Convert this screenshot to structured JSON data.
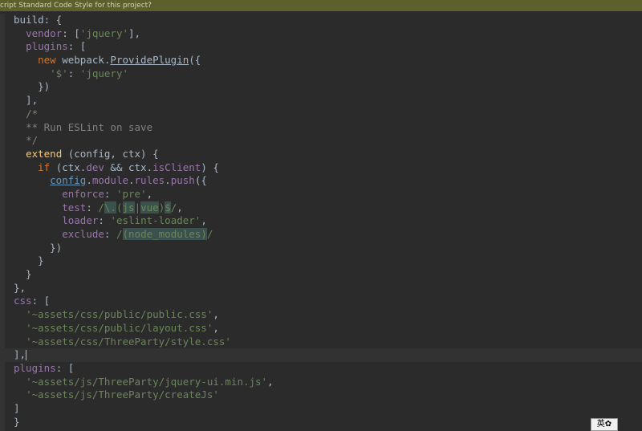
{
  "notification": {
    "text": "cript Standard Code Style for this project?"
  },
  "ime": {
    "label": "英✿"
  },
  "editor": {
    "lines": [
      "build: {",
      "vendor: ['jquery'],",
      "plugins: [",
      "new webpack.ProvidePlugin({",
      "'$': 'jquery'",
      "})",
      "],",
      "/*",
      "** Run ESLint on save",
      "*/",
      "extend (config, ctx) {",
      "if (ctx.dev && ctx.isClient) {",
      "config.module.rules.push({",
      "enforce: 'pre',",
      "test: /\\.(js|vue)$/,",
      "loader: 'eslint-loader',",
      "exclude: /(node_modules)/",
      "})",
      "}",
      "}",
      "},",
      "css: [",
      "'~assets/css/public/public.css',",
      "'~assets/css/public/layout.css',",
      "'~assets/css/ThreeParty/style.css'",
      "],",
      "plugins: [",
      "'~assets/js/ThreeParty/jquery-ui.min.js',",
      "'~assets/js/ThreeParty/createJs'",
      "]",
      "}"
    ]
  }
}
